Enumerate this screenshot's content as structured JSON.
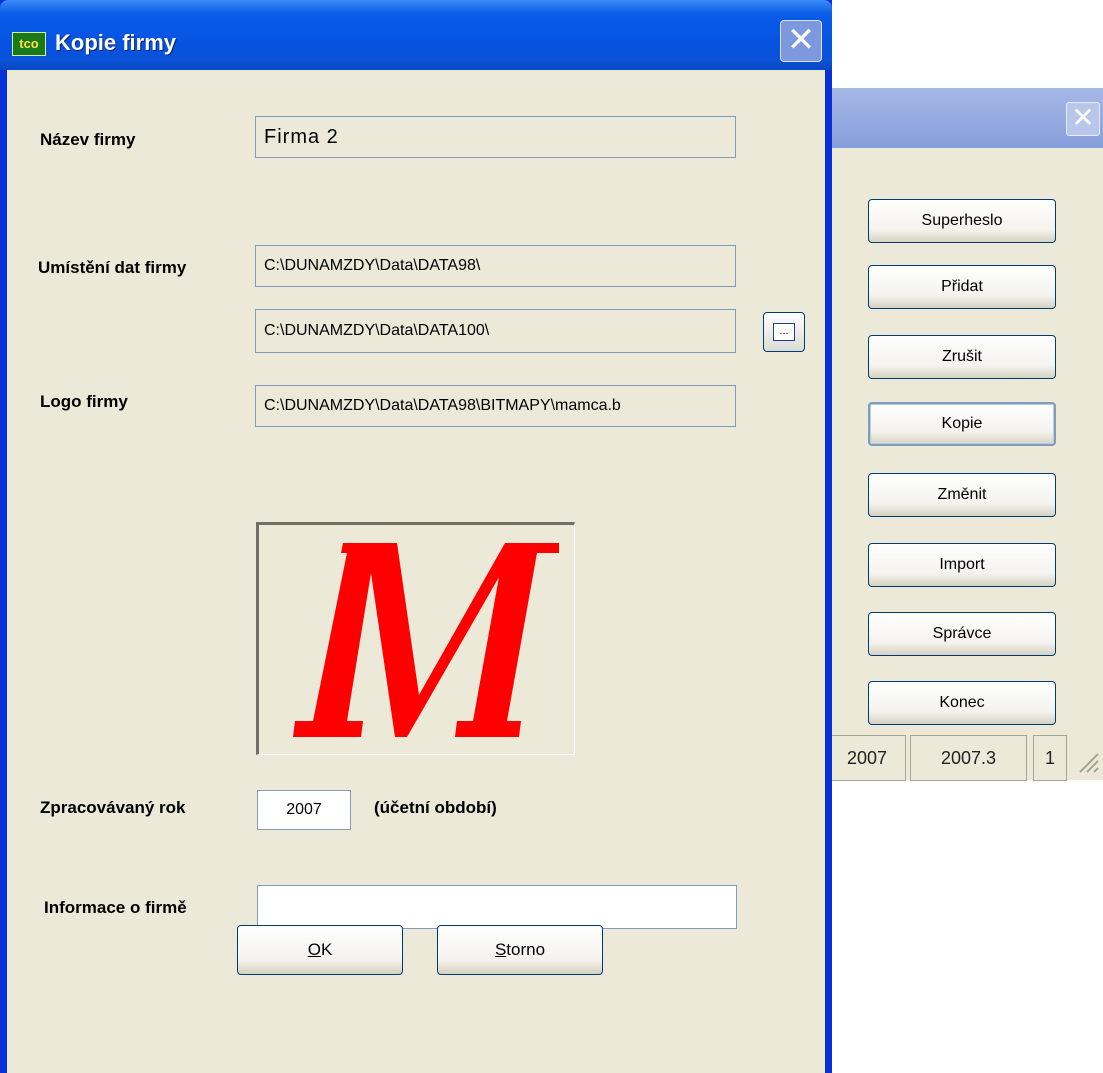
{
  "background_window": {
    "buttons": [
      "Superheslo",
      "Přidat",
      "Zrušit",
      "Kopie",
      "Změnit",
      "Import",
      "Správce",
      "Konec"
    ],
    "status": {
      "year": "2007",
      "version": "2007.3",
      "page": "1"
    }
  },
  "dialog": {
    "title": "Kopie firmy",
    "app_icon": "tco",
    "labels": {
      "name": "Název firmy",
      "data_location": "Umístění dat firmy",
      "logo": "Logo firmy",
      "year": "Zpracovávaný rok",
      "year_note": "(účetní období)",
      "info": "Informace o firmě"
    },
    "fields": {
      "name": "Firma 2",
      "data_path_source": "C:\\DUNAMZDY\\Data\\DATA98\\",
      "data_path_target": "C:\\DUNAMZDY\\Data\\DATA100\\",
      "logo_path": "C:\\DUNAMZDY\\Data\\DATA98\\BITMAPY\\mamca.b",
      "year": "2007",
      "info": ""
    },
    "browse_label": "...",
    "logo_letter": "M",
    "logo_color": "#ff0000",
    "buttons": {
      "ok_prefix": "",
      "ok_underlined": "O",
      "ok_rest": "K",
      "cancel_underlined": "S",
      "cancel_rest": "torno"
    }
  }
}
